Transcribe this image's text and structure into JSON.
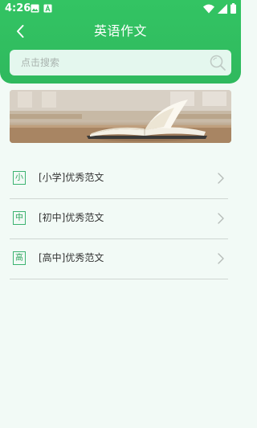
{
  "status_bar": {
    "time": "4:26",
    "left_icons": [
      "gallery-icon",
      "a-icon"
    ],
    "right_icons": [
      "wifi-icon",
      "signal-icon",
      "battery-icon"
    ]
  },
  "header": {
    "title": "英语作文",
    "back_icon": "back-arrow-icon"
  },
  "search": {
    "placeholder": "点击搜索",
    "icon": "search-icon"
  },
  "banner": {
    "image": "open-book-on-desk"
  },
  "list": {
    "items": [
      {
        "badge": "小",
        "label": "[小学]优秀范文"
      },
      {
        "badge": "中",
        "label": "[初中]优秀范文"
      },
      {
        "badge": "高",
        "label": "[高中]优秀范文"
      }
    ]
  },
  "colors": {
    "header": "#33c463",
    "accent": "#2aa35a",
    "background": "#f2faf6",
    "search_bg": "#e4f7ee"
  }
}
